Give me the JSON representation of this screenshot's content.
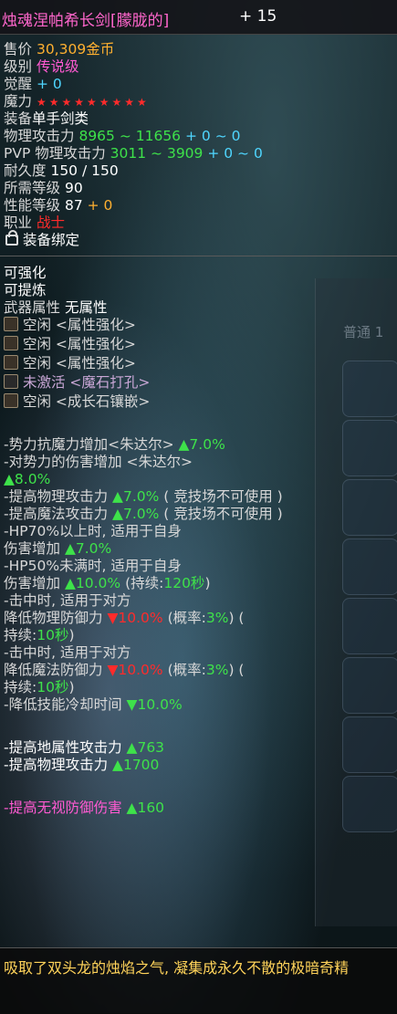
{
  "header": {
    "name": "烛魂涅帕希长剑[朦胧的]",
    "enhance": "+ 15"
  },
  "stats": {
    "price_label": "售价",
    "price_value": "30,309金币",
    "grade_label": "级别",
    "grade_value": "传说级",
    "awaken_label": "觉醒",
    "awaken_value": "+ 0",
    "magic_label": "魔力",
    "magic_stars": "★★★★★★★★★",
    "equip_label": "装备",
    "equip_value": "单手剑类",
    "patk_label": "物理攻击力",
    "patk_value": "8965 ~ 11656",
    "patk_bonus": "+ 0 ~ 0",
    "pvp_label": "PVP 物理攻击力",
    "pvp_value": "3011 ~ 3909",
    "pvp_bonus": "+ 0 ~ 0",
    "dur_label": "耐久度",
    "dur_value": "150 / 150",
    "req_label": "所需等级",
    "req_value": "90",
    "perf_label": "性能等级",
    "perf_value": "87",
    "perf_bonus": "+ 0",
    "job_label": "职业",
    "job_value": "战士",
    "bind_text": "装备绑定"
  },
  "enhance": {
    "can_enhance": "可强化",
    "can_refine": "可提炼",
    "attr_label": "武器属性",
    "attr_value": "无属性",
    "slots": [
      {
        "text": "空闲 <属性强化>"
      },
      {
        "text": "空闲 <属性强化>"
      },
      {
        "text": "空闲 <属性强化>"
      },
      {
        "text": "未激活 <魔石打孔>"
      },
      {
        "text": "空闲 <成长石镶嵌>"
      }
    ]
  },
  "effects": {
    "e1_text": "-势力抗魔力增加<朱达尔>",
    "e1_val": "▲7.0%",
    "e2_text": "-对势力的伤害增加 <朱达尔>",
    "e2_val": "▲8.0%",
    "e3_text": "-提高物理攻击力",
    "e3_val": "▲7.0%",
    "e3_note": "( 竞技场不可使用 )",
    "e4_text": "-提高魔法攻击力",
    "e4_val": "▲7.0%",
    "e4_note": "( 竞技场不可使用 )",
    "e5_text": "-HP70%以上时, 适用于自身",
    "e5b_text": "伤害增加",
    "e5_val": "▲7.0%",
    "e6_text": "-HP50%未满时, 适用于自身",
    "e6b_text": "伤害增加",
    "e6_val": "▲10.0%",
    "e6_dur_label": "(持续:",
    "e6_dur": "120秒",
    "e6_close": ")",
    "e7_text": "-击中时, 适用于对方",
    "e7b_text": "降低物理防御力",
    "e7_val": "▼10.0%",
    "e7_prob_label": "(概率:",
    "e7_prob": "3%",
    "e7_close": ") (",
    "e7c_label": "持续:",
    "e7_dur": "10秒",
    "e7c_close": ")",
    "e8_text": "-击中时, 适用于对方",
    "e8b_text": "降低魔法防御力",
    "e8_val": "▼10.0%",
    "e8_prob_label": "(概率:",
    "e8_prob": "3%",
    "e8_close": ") (",
    "e8c_label": "持续:",
    "e8_dur": "10秒",
    "e8c_close": ")",
    "e9_text": "-降低技能冷却时间",
    "e9_val": "▼10.0%",
    "e10_text": "-提高地属性攻击力",
    "e10_val": "▲763",
    "e11_text": "-提高物理攻击力",
    "e11_val": "▲1700",
    "e12_text": "-提高无视防御伤害",
    "e12_val": "▲160"
  },
  "background": {
    "side_tab": "普通 1"
  },
  "footer": {
    "desc": "吸取了双头龙的烛焰之气, 凝集成永久不散的极暗奇精"
  }
}
